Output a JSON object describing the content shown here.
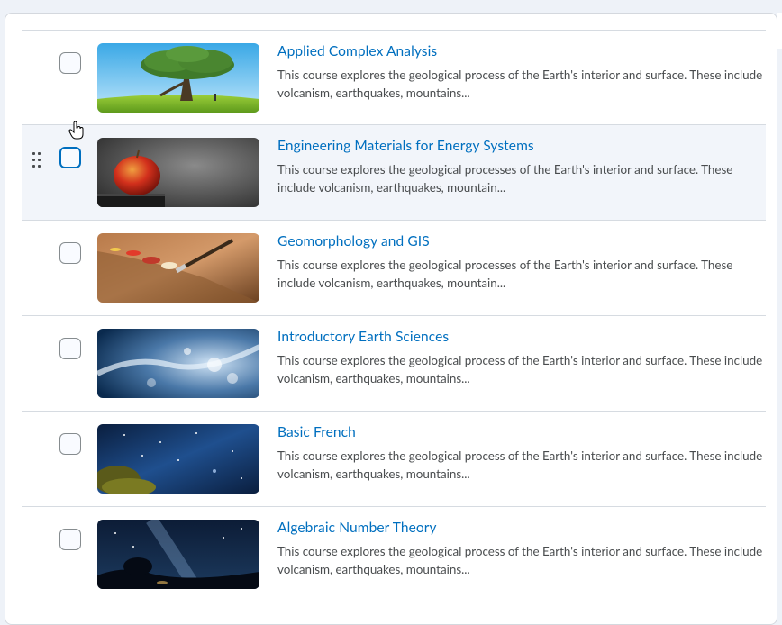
{
  "courses": [
    {
      "title": "Applied Complex Analysis",
      "description": "This course explores the geological process of the Earth's interior and surface. These include volcanism, earthquakes, mountains...",
      "image": "tree-on-hill"
    },
    {
      "title": "Engineering Materials for Energy Systems",
      "description": "This course explores the geological processes of the Earth's interior and surface. These include volcanism, earthquakes, mountain...",
      "image": "red-apple"
    },
    {
      "title": "Geomorphology and GIS",
      "description": "This course explores the geological processes of the Earth's interior and surface. These include volcanism, earthquakes, mountain...",
      "image": "paint-palette"
    },
    {
      "title": "Introductory Earth Sciences",
      "description": "This course explores the geological process of the Earth's interior and surface. These include volcanism, earthquakes, mountains...",
      "image": "water-splash"
    },
    {
      "title": "Basic French",
      "description": "This course explores the geological process of the Earth's interior and surface. These include volcanism, earthquakes, mountains...",
      "image": "starry-sky-tree"
    },
    {
      "title": "Algebraic Number Theory",
      "description": "This course explores the geological process of the Earth's interior and surface. These include volcanism, earthquakes, mountains...",
      "image": "milky-way-night"
    }
  ],
  "colors": {
    "link": "#006fbf",
    "text": "#494c4e",
    "hover_row": "#f2f5fa",
    "border": "#d6dbe1"
  }
}
